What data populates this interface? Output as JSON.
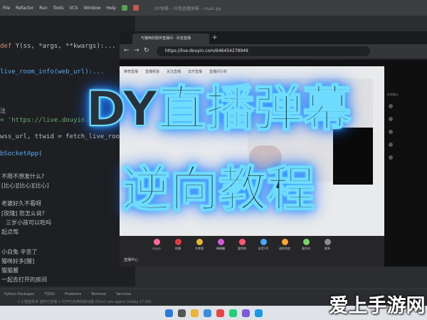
{
  "ide": {
    "menu": [
      "File",
      "Refactor",
      "Run",
      "Tools",
      "VCS",
      "Window",
      "Help"
    ],
    "title": "DY弹幕 – 抖音直播弹幕 – main.py",
    "code_lines": [
      {
        "text": "Y(ss, *args, **kwargs):..."
      },
      {
        "text": "live_room_info(web_url):..."
      },
      {
        "text": "注"
      },
      {
        "text": "= 'https://live.douyin.com/'"
      },
      {
        "text": "wss_url, ttwid = fetch_live_room"
      },
      {
        "text": "bSocketApp("
      }
    ],
    "comments": [
      "不限不想发什么?",
      "[比心][比心][比心]",
      "老婆好久不看呀",
      "[玫瑰] 您怎么说?",
      "三岁小孩可以吃吗",
      "起点驾",
      "小白兔 辛苦了",
      "猫咪好多[酸]",
      "猫猫酱",
      "一起去打开的房间"
    ],
    "status": [
      "Python Packages",
      "TODO",
      "Problems",
      "Terminal",
      "Services"
    ],
    "message": "人工智能技术 插件已安装 // 打开已启用的新功能 (Don't ask again) (today 17:06)"
  },
  "browser": {
    "tab_title": "与猫咪的陪伴直播间 - 抖音直播",
    "url": "https://live.douyin.com/646454278949"
  },
  "douyin": {
    "tabs": [
      "推荐直播",
      "直播频道",
      "关注直播",
      "去开直播",
      "直播间分析"
    ],
    "gifts": [
      "小心心",
      "玫瑰",
      "大啤酒",
      "棒棒糖",
      "爱你哟",
      "抖音1号",
      "送你花花",
      "直升机",
      "更多"
    ],
    "more_label": "直播中心",
    "rightcol_label": "在线观众"
  },
  "overlay": {
    "headline": "DY直播弹幕",
    "subhead": "逆向教程"
  },
  "watermark": "爱上手游网",
  "colors": {
    "headline_glow": "#35b4ff",
    "headline_fill": "#27323c",
    "ide_bg": "#1e1f22"
  }
}
